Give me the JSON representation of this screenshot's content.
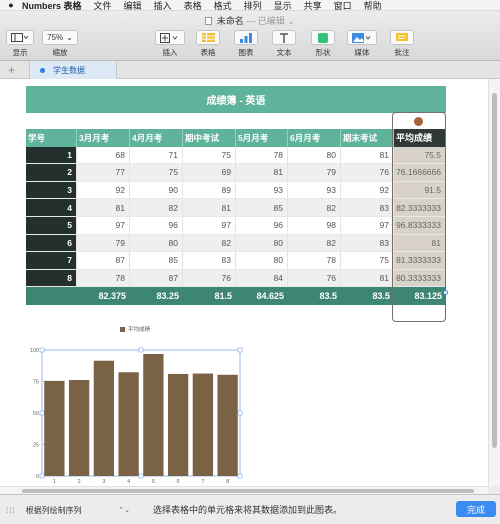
{
  "menubar": {
    "app_name": "Numbers 表格",
    "items": [
      "文件",
      "编辑",
      "插入",
      "表格",
      "格式",
      "排列",
      "显示",
      "共享",
      "窗口",
      "帮助"
    ]
  },
  "document": {
    "title": "未命名",
    "status": "— 已编辑"
  },
  "toolbar": {
    "view_label": "显示",
    "zoom_value": "75%",
    "zoom_label": "缩放",
    "insert_label": "插入",
    "table_label": "表格",
    "chart_label": "图表",
    "text_label": "文本",
    "shape_label": "形状",
    "media_label": "媒体",
    "comment_label": "批注"
  },
  "sheet": {
    "tab_name": "学生数据"
  },
  "table": {
    "title": "成绩簿 - 英语",
    "headers": [
      "学号",
      "3月月考",
      "4月月考",
      "期中考试",
      "5月月考",
      "6月月考",
      "期末考试",
      "平均成绩"
    ],
    "rows": [
      [
        "1",
        "68",
        "71",
        "75",
        "78",
        "80",
        "81",
        "75.5"
      ],
      [
        "2",
        "77",
        "75",
        "69",
        "81",
        "79",
        "76",
        "76.1666666"
      ],
      [
        "3",
        "92",
        "90",
        "89",
        "93",
        "93",
        "92",
        "91.5"
      ],
      [
        "4",
        "81",
        "82",
        "81",
        "85",
        "82",
        "83",
        "82.3333333"
      ],
      [
        "5",
        "97",
        "96",
        "97",
        "96",
        "98",
        "97",
        "96.8333333"
      ],
      [
        "6",
        "79",
        "80",
        "82",
        "80",
        "82",
        "83",
        "81"
      ],
      [
        "7",
        "87",
        "85",
        "83",
        "80",
        "78",
        "75",
        "81.3333333"
      ],
      [
        "8",
        "78",
        "87",
        "76",
        "84",
        "76",
        "81",
        "80.3333333"
      ]
    ],
    "footer": [
      "",
      "82.375",
      "83.25",
      "81.5",
      "84.625",
      "83.5",
      "83.5",
      "83.125"
    ]
  },
  "chart_data": {
    "type": "bar",
    "categories": [
      "1",
      "2",
      "3",
      "4",
      "5",
      "6",
      "7",
      "8"
    ],
    "series": [
      {
        "name": "平均成绩",
        "values": [
          75.5,
          76.17,
          91.5,
          82.33,
          96.83,
          81,
          81.33,
          80.33
        ]
      }
    ],
    "yticks": [
      "0",
      "25",
      "50",
      "75",
      "100"
    ],
    "ylim": [
      0,
      100
    ],
    "legend_position": "top",
    "bar_color": "#7a6244"
  },
  "bottombar": {
    "series_toggle": "根据列绘制序列",
    "hint": "选择表格中的单元格来将其数据添加到此图表。",
    "done_label": "完成"
  }
}
